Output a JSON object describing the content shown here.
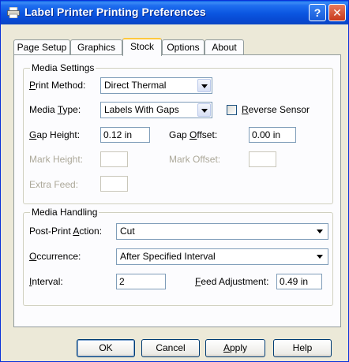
{
  "window": {
    "title": "Label Printer Printing Preferences",
    "help_glyph": "?",
    "close_glyph": "✕"
  },
  "tabs": [
    {
      "label": "Page Setup"
    },
    {
      "label": "Graphics"
    },
    {
      "label": "Stock",
      "active": true
    },
    {
      "label": "Options"
    },
    {
      "label": "About"
    }
  ],
  "media_settings": {
    "group_label": "Media Settings",
    "print_method": {
      "label_pre": "",
      "label_ul": "P",
      "label_post": "rint Method:",
      "value": "Direct Thermal"
    },
    "media_type": {
      "label_pre": "Media ",
      "label_ul": "T",
      "label_post": "ype:",
      "value": "Labels With Gaps"
    },
    "reverse_sensor": {
      "label_ul": "R",
      "label_post": "everse Sensor",
      "checked": false
    },
    "gap_height": {
      "label_ul": "G",
      "label_post": "ap Height:",
      "value": "0.12 in"
    },
    "gap_offset": {
      "label_pre": "Gap ",
      "label_ul": "O",
      "label_post": "ffset:",
      "value": "0.00 in"
    },
    "mark_height": {
      "label": "Mark Height:",
      "value": ""
    },
    "mark_offset": {
      "label": "Mark Offset:",
      "value": ""
    },
    "extra_feed": {
      "label": "Extra Feed:",
      "value": ""
    }
  },
  "media_handling": {
    "group_label": "Media Handling",
    "post_print_action": {
      "label_pre": "Post-Print ",
      "label_ul": "A",
      "label_post": "ction:",
      "value": "Cut"
    },
    "occurrence": {
      "label_ul": "O",
      "label_post": "ccurrence:",
      "value": "After Specified Interval"
    },
    "interval": {
      "label_ul": "I",
      "label_post": "nterval:",
      "value": "2"
    },
    "feed_adjustment": {
      "label_ul": "F",
      "label_post": "eed Adjustment:",
      "value": "0.49 in"
    }
  },
  "buttons": {
    "ok": "OK",
    "cancel": "Cancel",
    "apply_ul": "A",
    "apply_post": "pply",
    "help": "Help"
  }
}
